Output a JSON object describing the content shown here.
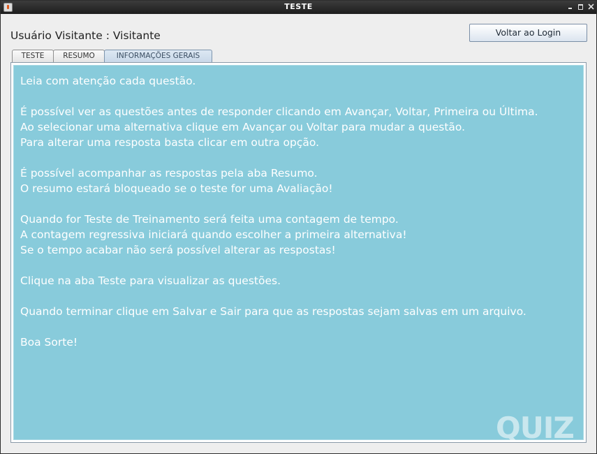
{
  "window": {
    "title": "TESTE",
    "controls": {
      "minimize_icon": "minimize-icon",
      "maximize_icon": "maximize-icon",
      "close_icon": "close-icon"
    }
  },
  "header": {
    "user_label": "Usuário Visitante : Visitante",
    "login_button": "Voltar ao Login"
  },
  "tabs": [
    {
      "label": "TESTE",
      "selected": false
    },
    {
      "label": "RESUMO",
      "selected": false
    },
    {
      "label": "INFORMAÇÕES GERAIS",
      "selected": true
    }
  ],
  "info": {
    "paragraphs": [
      [
        "Leia com atenção cada questão."
      ],
      [
        "É possível ver as questões antes de responder clicando em Avançar, Voltar, Primeira ou Última.",
        "Ao selecionar uma alternativa clique em Avançar ou Voltar para mudar a questão.",
        "Para alterar uma resposta basta clicar em outra opção."
      ],
      [
        "É possível acompanhar as respostas pela aba Resumo.",
        "O resumo estará bloqueado se o teste for uma Avaliação!"
      ],
      [
        "Quando for Teste de Treinamento será feita uma contagem de tempo.",
        "A contagem regressiva iniciará quando escolher a primeira alternativa!",
        "Se o tempo acabar não será possível alterar as respostas!"
      ],
      [
        "Clique na aba Teste para visualizar as questões."
      ],
      [
        "Quando terminar clique em Salvar e Sair para que as respostas sejam salvas em um arquivo."
      ],
      [
        "Boa Sorte!"
      ]
    ],
    "logo": "QUIZ"
  },
  "colors": {
    "panel_background": "#88cbdb",
    "text": "#ffffff",
    "titlebar": "#2a2a2a",
    "selected_tab": "#c7d7e8"
  }
}
